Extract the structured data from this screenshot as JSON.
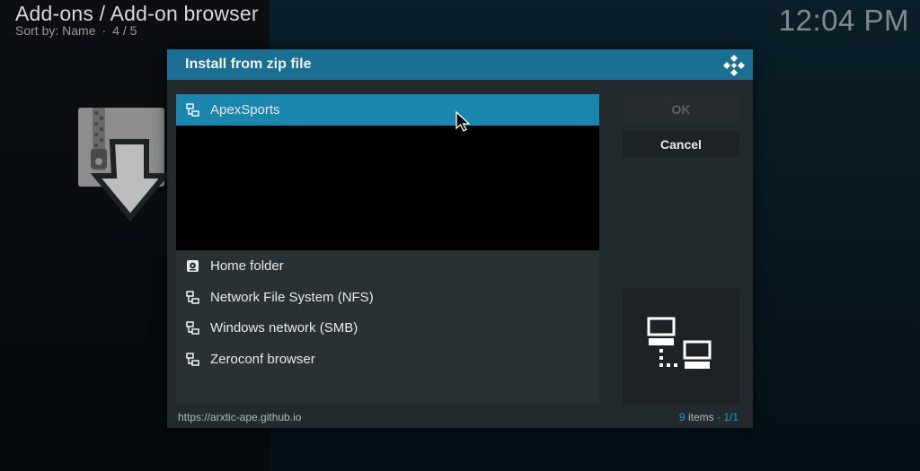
{
  "header": {
    "title": "Add-ons / Add-on browser",
    "sort_label": "Sort by: Name",
    "position": "4 / 5"
  },
  "clock": "12:04 PM",
  "dialog": {
    "title": "Install from zip file",
    "items": [
      {
        "label": "ApexSports",
        "icon": "network-drive-icon",
        "selected": true
      },
      {
        "label": "Home folder",
        "icon": "home-drive-icon",
        "selected": false
      },
      {
        "label": "Network File System (NFS)",
        "icon": "network-drive-icon",
        "selected": false
      },
      {
        "label": "Windows network (SMB)",
        "icon": "network-drive-icon",
        "selected": false
      },
      {
        "label": "Zeroconf browser",
        "icon": "network-drive-icon",
        "selected": false
      }
    ],
    "ok_label": "OK",
    "cancel_label": "Cancel",
    "footer_url": "https://arxtic-ape.github.io",
    "item_count": "9",
    "items_word": "items",
    "separator": "-",
    "page": "1/1"
  },
  "colors": {
    "accent": "#1a86ad",
    "header": "#1a6f93",
    "dialog_bg": "#232a2d"
  }
}
